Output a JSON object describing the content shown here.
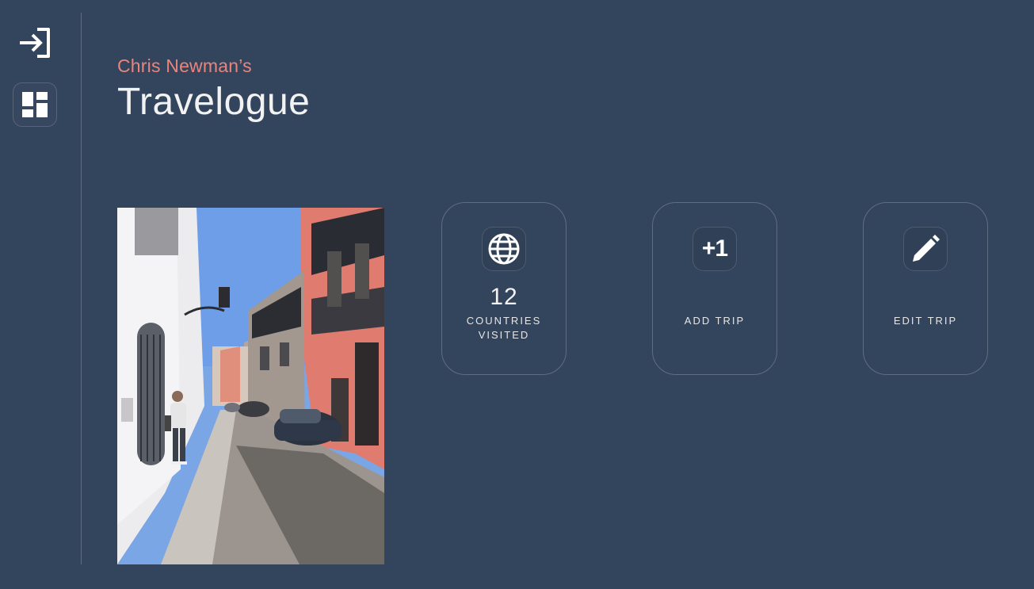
{
  "sidebar": {
    "items": [
      {
        "name": "login",
        "icon": "login-icon"
      },
      {
        "name": "dashboard",
        "icon": "dashboard-icon"
      }
    ]
  },
  "header": {
    "owner": "Chris Newman’s",
    "title": "Travelogue"
  },
  "photo": {
    "icon": "travel-photo"
  },
  "cards": {
    "countries": {
      "icon": "globe-icon",
      "count": "12",
      "label_line1": "COUNTRIES",
      "label_line2": "VISITED"
    },
    "add_trip": {
      "icon_text": "+1",
      "label": "ADD TRIP"
    },
    "edit_trip": {
      "icon": "pencil-icon",
      "label": "EDIT TRIP"
    }
  },
  "colors": {
    "background": "#33445d",
    "accent": "#e8857d"
  }
}
